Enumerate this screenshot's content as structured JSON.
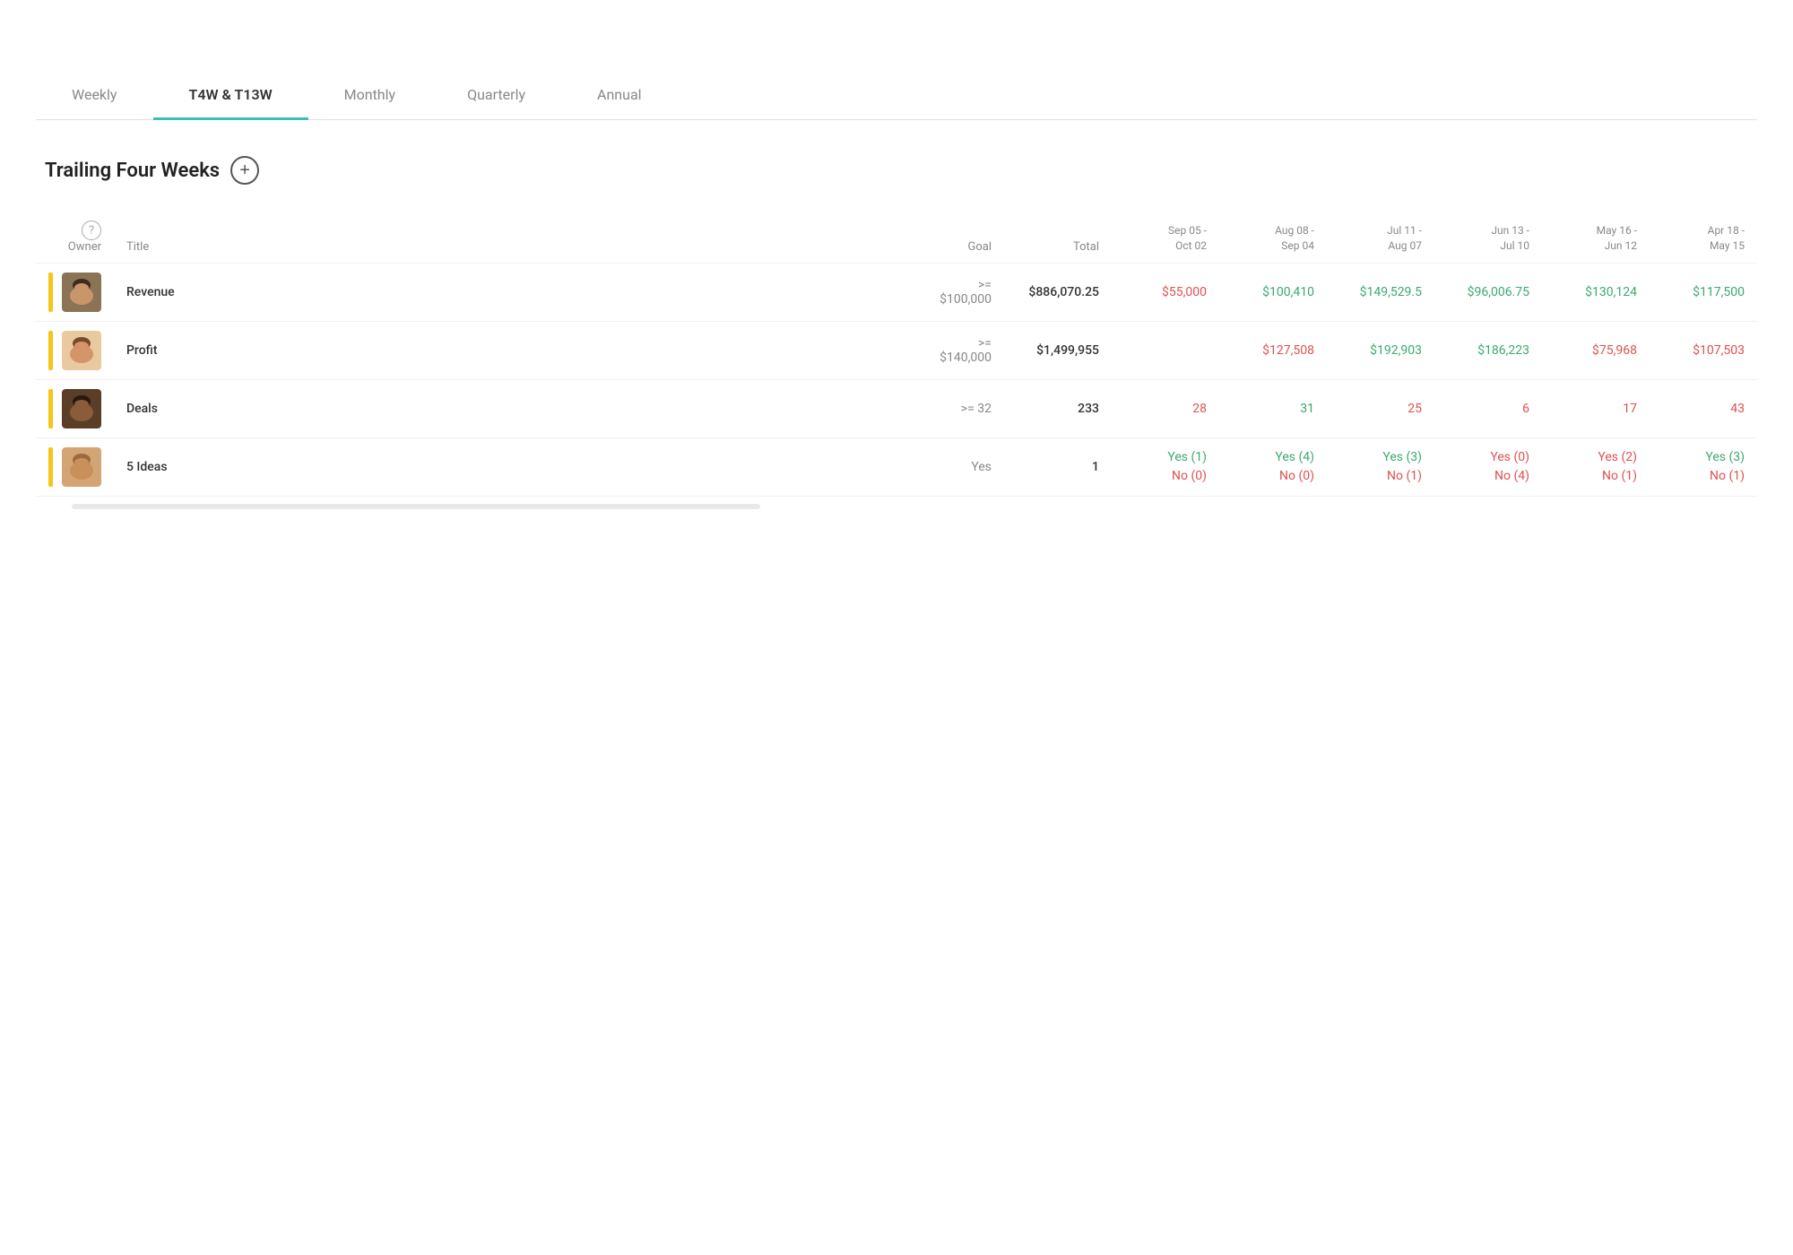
{
  "tabs": [
    {
      "id": "weekly",
      "label": "Weekly",
      "active": false
    },
    {
      "id": "t4w-t13w",
      "label": "T4W & T13W",
      "active": true
    },
    {
      "id": "monthly",
      "label": "Monthly",
      "active": false
    },
    {
      "id": "quarterly",
      "label": "Quarterly",
      "active": false
    },
    {
      "id": "annual",
      "label": "Annual",
      "active": false
    }
  ],
  "section": {
    "title": "Trailing Four Weeks",
    "add_button_label": "+"
  },
  "table": {
    "columns": {
      "owner_label": "Owner",
      "title_label": "Title",
      "goal_label": "Goal",
      "total_label": "Total",
      "periods": [
        {
          "id": "p1",
          "line1": "Sep 05 -",
          "line2": "Oct 02"
        },
        {
          "id": "p2",
          "line1": "Aug 08 -",
          "line2": "Sep 04"
        },
        {
          "id": "p3",
          "line1": "Jul 11 -",
          "line2": "Aug 07"
        },
        {
          "id": "p4",
          "line1": "Jun 13 -",
          "line2": "Jul 10"
        },
        {
          "id": "p5",
          "line1": "May 16 -",
          "line2": "Jun 12"
        },
        {
          "id": "p6",
          "line1": "Apr 18 -",
          "line2": "May 15"
        }
      ]
    },
    "rows": [
      {
        "id": "revenue",
        "avatar_bg": "#8B6B4A",
        "title": "Revenue",
        "goal": ">= $100,000",
        "total": "$886,070.25",
        "total_color": "dark",
        "periods": [
          {
            "value": "$55,000",
            "color": "red"
          },
          {
            "value": "$100,410",
            "color": "green"
          },
          {
            "value": "$149,529.5",
            "color": "green"
          },
          {
            "value": "$96,006.75",
            "color": "green"
          },
          {
            "value": "$130,124",
            "color": "green"
          },
          {
            "value": "$117,500",
            "color": "green"
          }
        ]
      },
      {
        "id": "profit",
        "avatar_bg": "#C8956A",
        "title": "Profit",
        "goal": ">= $140,000",
        "total": "$1,499,955",
        "total_color": "dark",
        "periods": [
          {
            "value": "",
            "color": "dark"
          },
          {
            "value": "$127,508",
            "color": "red"
          },
          {
            "value": "$192,903",
            "color": "green"
          },
          {
            "value": "$186,223",
            "color": "green"
          },
          {
            "value": "$75,968",
            "color": "red"
          },
          {
            "value": "$107,503",
            "color": "red"
          }
        ]
      },
      {
        "id": "deals",
        "avatar_bg": "#4A3020",
        "title": "Deals",
        "goal": ">= 32",
        "total": "233",
        "total_color": "dark",
        "periods": [
          {
            "value": "28",
            "color": "red"
          },
          {
            "value": "31",
            "color": "green"
          },
          {
            "value": "25",
            "color": "red"
          },
          {
            "value": "6",
            "color": "red"
          },
          {
            "value": "17",
            "color": "red"
          },
          {
            "value": "43",
            "color": "red"
          }
        ]
      },
      {
        "id": "5ideas",
        "avatar_bg": "#D4A574",
        "title": "5 Ideas",
        "goal": "Yes",
        "total": "1",
        "total_color": "dark",
        "periods": [
          {
            "value": "Yes (1)\nNo (0)",
            "color": "green",
            "line1": "Yes (1)",
            "line1_color": "green",
            "line2": "No (0)",
            "line2_color": "red"
          },
          {
            "value": "Yes (4)\nNo (0)",
            "color": "green",
            "line1": "Yes (4)",
            "line1_color": "green",
            "line2": "No (0)",
            "line2_color": "red"
          },
          {
            "value": "Yes (3)\nNo (1)",
            "color": "green",
            "line1": "Yes (3)",
            "line1_color": "green",
            "line2": "No (1)",
            "line2_color": "red"
          },
          {
            "value": "Yes (0)\nNo (4)",
            "color": "red",
            "line1": "Yes (0)",
            "line1_color": "red",
            "line2": "No (4)",
            "line2_color": "red"
          },
          {
            "value": "Yes (2)\nNo (1)",
            "color": "red",
            "line1": "Yes (2)",
            "line1_color": "red",
            "line2": "No (1)",
            "line2_color": "red"
          },
          {
            "value": "Yes (3)\nNo (1)",
            "color": "green",
            "line1": "Yes (3)",
            "line1_color": "green",
            "line2": "No (1)",
            "line2_color": "red"
          }
        ]
      }
    ]
  }
}
